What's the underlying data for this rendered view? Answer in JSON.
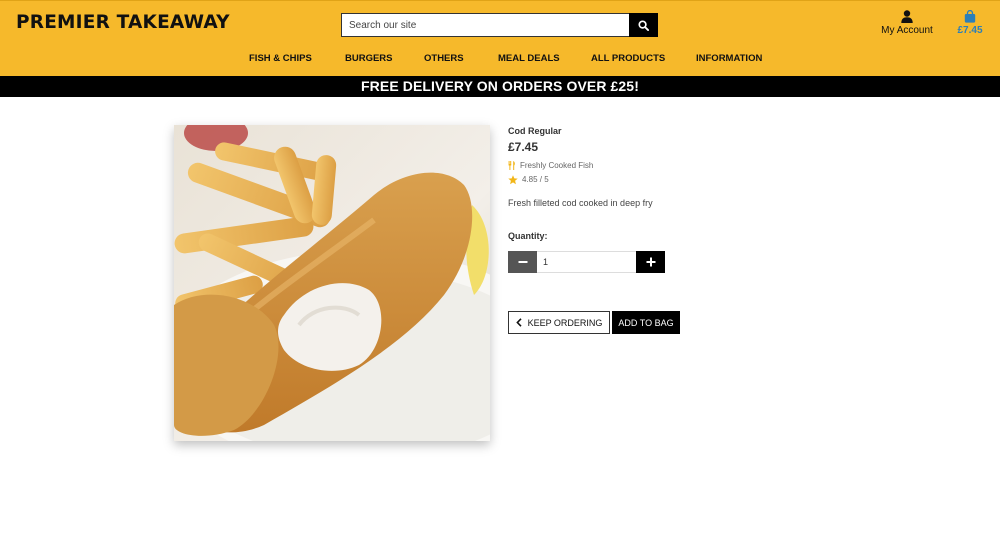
{
  "header": {
    "brand": "PREMIER TAKEAWAY",
    "search_placeholder": "Search our site",
    "account_label": "My Account",
    "bag_total": "£7.45",
    "bag_color": "#2c7fb8",
    "background": "#f6b92b"
  },
  "nav": {
    "items": [
      {
        "label": "FISH & CHIPS"
      },
      {
        "label": "BURGERS"
      },
      {
        "label": "OTHERS"
      },
      {
        "label": "MEAL DEALS"
      },
      {
        "label": "ALL PRODUCTS"
      },
      {
        "label": "INFORMATION"
      }
    ]
  },
  "banner": {
    "text": "FREE DELIVERY ON ORDERS OVER £25!"
  },
  "product": {
    "name": "Cod Regular",
    "price": "£7.45",
    "category": "Freshly Cooked Fish",
    "category_icon": "utensils-icon",
    "rating": "4.85 / 5",
    "rating_icon": "star-icon",
    "description": "Fresh filleted cod cooked in deep fry",
    "quantity_label": "Quantity:",
    "quantity_value": "1"
  },
  "actions": {
    "keep_ordering": "KEEP ORDERING",
    "add_to_bag": "ADD TO BAG"
  }
}
